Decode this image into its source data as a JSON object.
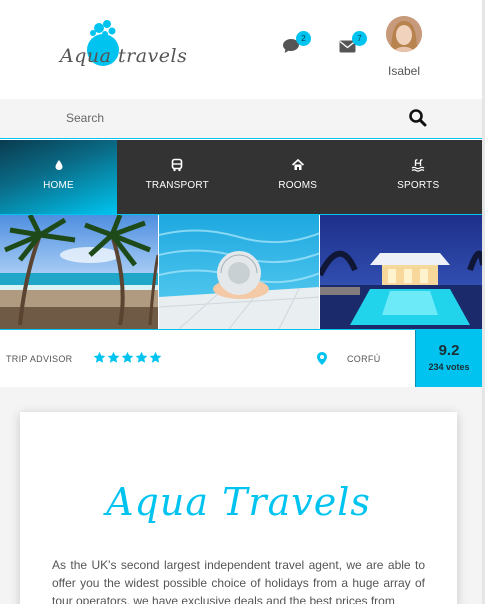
{
  "brand": {
    "name": "Aqua travels",
    "accent_color": "#00c4ef"
  },
  "header": {
    "messages_icon": "chat-bubble-icon",
    "messages_count": "2",
    "mail_icon": "envelope-icon",
    "mail_count": "7",
    "user_name": "Isabel"
  },
  "search": {
    "placeholder": "Search",
    "icon": "search-icon"
  },
  "nav": {
    "items": [
      {
        "label": "HOME",
        "icon": "water-drop-icon",
        "active": true
      },
      {
        "label": "TRANSPORT",
        "icon": "bus-icon",
        "active": false
      },
      {
        "label": "ROOMS",
        "icon": "home-icon",
        "active": false
      },
      {
        "label": "SPORTS",
        "icon": "pool-icon",
        "active": false
      }
    ]
  },
  "gallery": {
    "photos": [
      "beach-palms",
      "pool-hat",
      "resort-pool-night"
    ]
  },
  "info": {
    "rating_source": "TRIP ADVISOR",
    "stars": 5,
    "location": "CORFÚ",
    "score": "9.2",
    "votes": "234 votes"
  },
  "card": {
    "title": "Aqua Travels",
    "body": "As the UK's second largest independent travel agent, we are able to offer you the widest possible choice of holidays from a huge array of tour operators, we have exclusive deals and the best prices from"
  }
}
